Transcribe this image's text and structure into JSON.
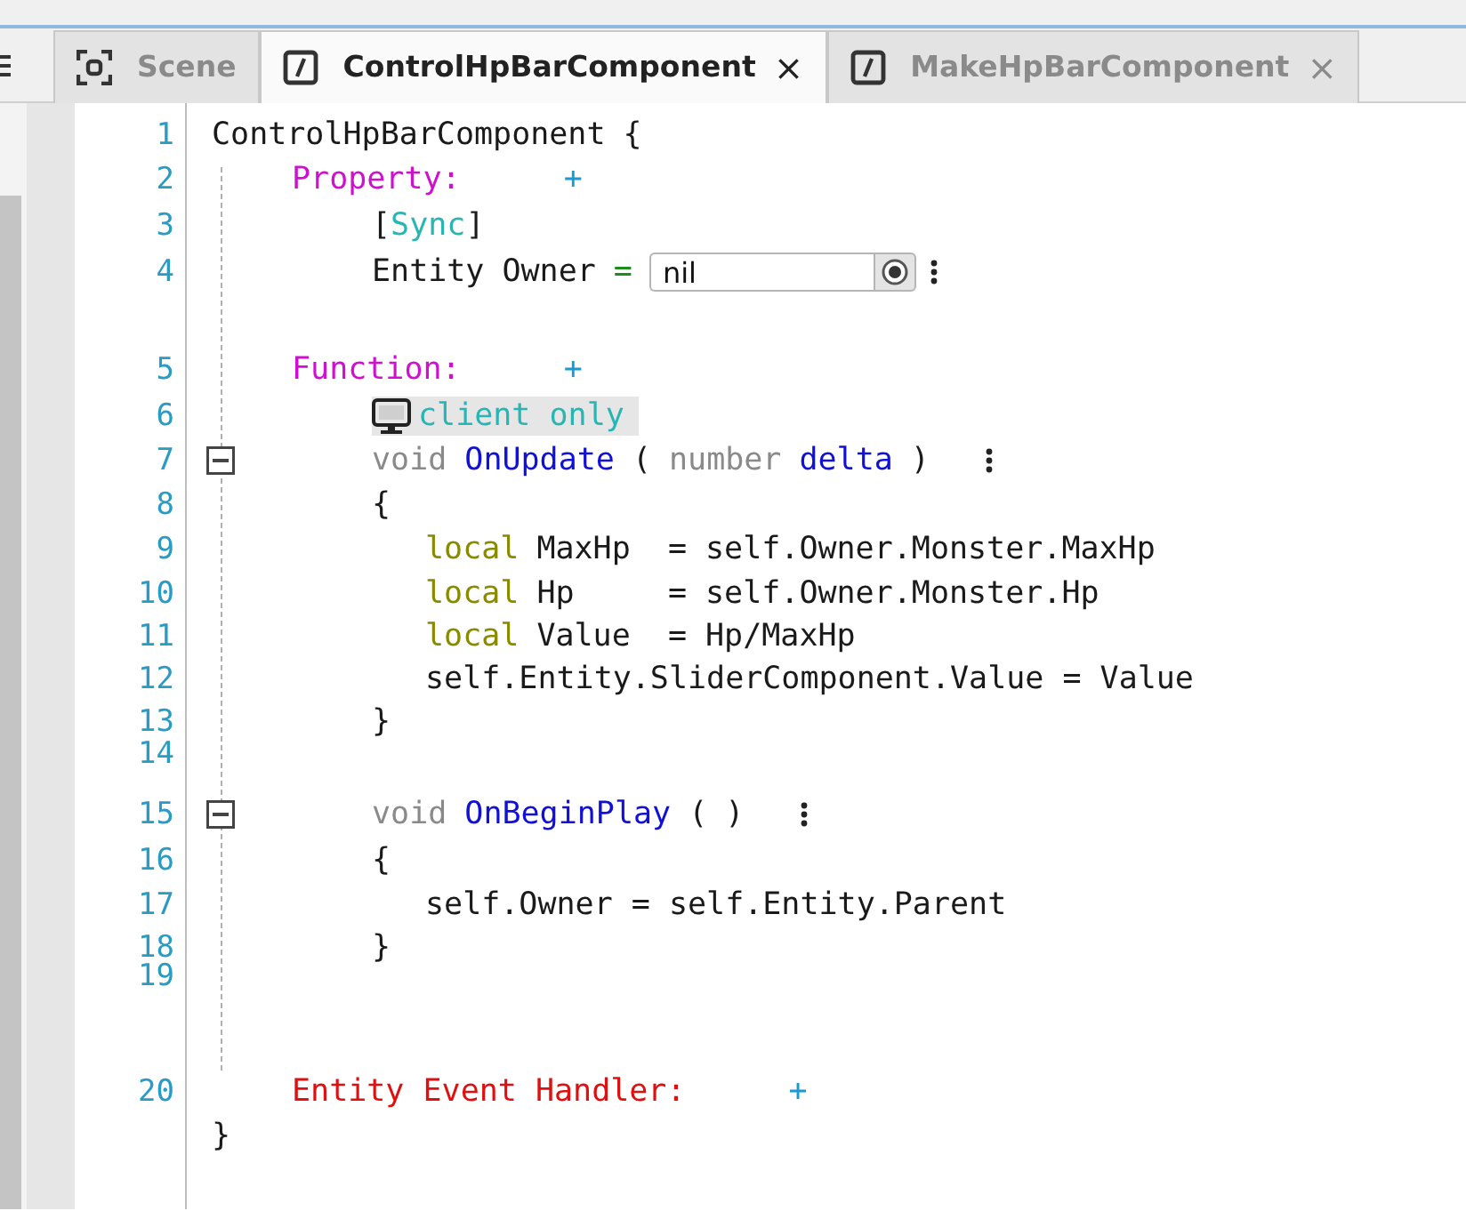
{
  "tabs": [
    {
      "kind": "scene",
      "label": "Scene",
      "selected": false
    },
    {
      "kind": "script",
      "label": "ControlHpBarComponent",
      "selected": true,
      "close": "×"
    },
    {
      "kind": "script",
      "label": "MakeHpBarComponent",
      "selected": false,
      "close": "×"
    }
  ],
  "lines": [
    {
      "number": "1",
      "kind": "header",
      "tokens": [
        {
          "kind": "plain",
          "text": "ControlHpBarComponent"
        },
        {
          "kind": "plain",
          "text": "{"
        }
      ]
    },
    {
      "number": "2",
      "kind": "section",
      "tokens": [
        {
          "kind": "section",
          "text": "Property:"
        },
        {
          "kind": "add",
          "text": "+"
        }
      ]
    },
    {
      "number": "3",
      "kind": "member",
      "tokens": [
        {
          "kind": "plain",
          "text": "["
        },
        {
          "kind": "attribute",
          "text": "Sync"
        },
        {
          "kind": "plain",
          "text": "]"
        }
      ]
    },
    {
      "number": "4",
      "kind": "property",
      "tokens": [
        {
          "kind": "plain",
          "text": "Entity"
        },
        {
          "kind": "plain",
          "text": "Owner"
        },
        {
          "kind": "operator",
          "text": "="
        }
      ],
      "field": {
        "value": "nil"
      },
      "menu": true
    },
    {
      "number": "5",
      "kind": "section",
      "tokens": [
        {
          "kind": "section",
          "text": "Function:"
        },
        {
          "kind": "add",
          "text": "+"
        }
      ]
    },
    {
      "number": "6",
      "kind": "annotation",
      "tokens": [
        {
          "kind": "tag",
          "text": "client only"
        }
      ]
    },
    {
      "number": "7",
      "kind": "function",
      "expanded": true,
      "menu": true,
      "tokens": [
        {
          "kind": "muted",
          "text": "void"
        },
        {
          "kind": "function",
          "text": "OnUpdate"
        },
        {
          "kind": "plain",
          "text": "("
        },
        {
          "kind": "muted",
          "text": "number"
        },
        {
          "kind": "function",
          "text": "delta"
        },
        {
          "kind": "plain",
          "text": ")"
        }
      ]
    },
    {
      "number": "8",
      "kind": "member",
      "tokens": [
        {
          "kind": "plain",
          "text": "{"
        }
      ]
    },
    {
      "number": "9",
      "kind": "statement",
      "tokens": [
        {
          "kind": "local",
          "text": "local"
        },
        {
          "kind": "plain",
          "text": "MaxHp  = self.Owner.Monster.MaxHp"
        }
      ]
    },
    {
      "number": "10",
      "kind": "statement",
      "tokens": [
        {
          "kind": "local",
          "text": "local"
        },
        {
          "kind": "plain",
          "text": "Hp     = self.Owner.Monster.Hp"
        }
      ]
    },
    {
      "number": "11",
      "kind": "statement",
      "tokens": [
        {
          "kind": "local",
          "text": "local"
        },
        {
          "kind": "plain",
          "text": "Value  = Hp/MaxHp"
        }
      ]
    },
    {
      "number": "12",
      "kind": "statement",
      "tokens": [
        {
          "kind": "plain",
          "text": "self.Entity.SliderComponent.Value = Value"
        }
      ]
    },
    {
      "number": "13",
      "kind": "member",
      "tokens": [
        {
          "kind": "plain",
          "text": "}"
        }
      ]
    },
    {
      "number": "14",
      "kind": "empty"
    },
    {
      "number": "15",
      "kind": "function",
      "expanded": true,
      "menu": true,
      "tokens": [
        {
          "kind": "muted",
          "text": "void"
        },
        {
          "kind": "function",
          "text": "OnBeginPlay"
        },
        {
          "kind": "plain",
          "text": "("
        },
        {
          "kind": "plain",
          "text": ")"
        }
      ]
    },
    {
      "number": "16",
      "kind": "member",
      "tokens": [
        {
          "kind": "plain",
          "text": "{"
        }
      ]
    },
    {
      "number": "17",
      "kind": "statement",
      "tokens": [
        {
          "kind": "plain",
          "text": "self.Owner = self.Entity.Parent"
        }
      ]
    },
    {
      "number": "18",
      "kind": "member",
      "tokens": [
        {
          "kind": "plain",
          "text": "}"
        }
      ]
    },
    {
      "number": "19",
      "kind": "empty"
    },
    {
      "number": "20",
      "kind": "section",
      "tokens": [
        {
          "kind": "event",
          "text": "Entity Event Handler:"
        },
        {
          "kind": "add",
          "text": "+"
        }
      ]
    },
    {
      "kind": "header",
      "tokens": [
        {
          "kind": "plain",
          "text": "}"
        }
      ]
    }
  ]
}
